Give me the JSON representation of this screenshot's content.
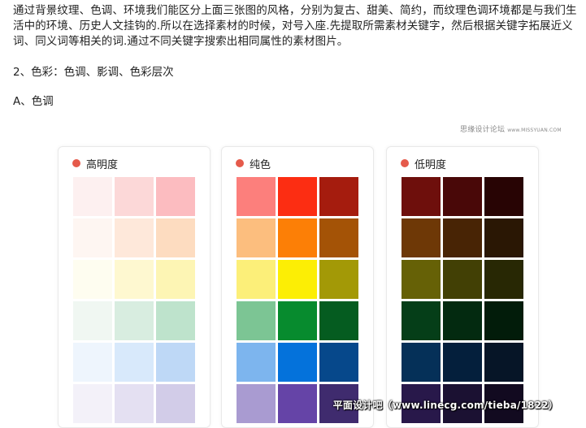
{
  "article": {
    "paragraph": "通过背景纹理、色调、环境我们能区分上面三张图的风格，分别为复古、甜美、简约，而纹理色调环境都是与我们生活中的环境、历史人文挂钩的.所以在选择素材的时候，对号入座.先提取所需素材关键字，然后根据关键字拓展近义词、同义词等相关的词.通过不同关键字搜索出相同属性的素材图片。",
    "section_heading": "2、色彩：色调、影调、色彩层次",
    "subsection_heading": "A、色调"
  },
  "image": {
    "credit": "思缘设计论坛",
    "credit_site": "www.MISSYUAN.COM",
    "watermark": "平面设计吧（www.linecg.com/tieba/1822）",
    "cards": [
      {
        "title": "高明度",
        "swatches": [
          "#fdf0f0",
          "#fcd8d8",
          "#fcbcc0",
          "#fef6f2",
          "#fee8da",
          "#fddcc0",
          "#fefdf0",
          "#fef8d0",
          "#fdf5b4",
          "#f0f7f2",
          "#d8ede0",
          "#bee3cc",
          "#eef5fd",
          "#d8e9fb",
          "#bed8f6",
          "#f3f1f9",
          "#e4e0f2",
          "#d2cce8"
        ]
      },
      {
        "title": "纯色",
        "swatches": [
          "#fc7f7c",
          "#fc2d12",
          "#a51c0e",
          "#fcbe7e",
          "#fc7f06",
          "#a45306",
          "#fcef79",
          "#fcee05",
          "#a39906",
          "#7cc594",
          "#078b2e",
          "#055c20",
          "#7db5ee",
          "#0472db",
          "#06488b",
          "#a99bd1",
          "#6544a7",
          "#3f2b6e"
        ]
      },
      {
        "title": "低明度",
        "swatches": [
          "#6e0f0c",
          "#490808",
          "#280404",
          "#6e3806",
          "#482405",
          "#2a1704",
          "#666106",
          "#424005",
          "#282804",
          "#053e18",
          "#032a10",
          "#021c0a",
          "#053058",
          "#041f3c",
          "#061527",
          "#28184a",
          "#1b1132",
          "#120a20"
        ]
      }
    ]
  }
}
